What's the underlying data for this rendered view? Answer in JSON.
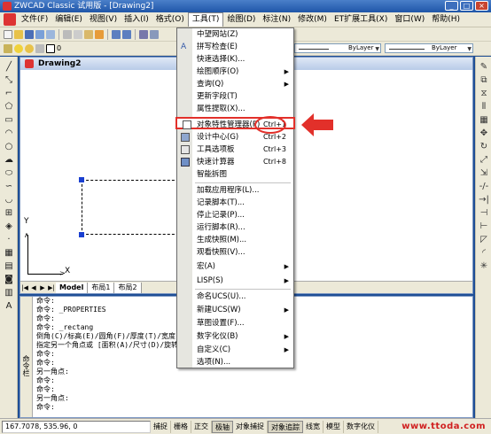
{
  "window": {
    "title": "ZWCAD Classic 试用版 - [Drawing2]"
  },
  "menubar": {
    "items": [
      "文件(F)",
      "编辑(E)",
      "视图(V)",
      "插入(I)",
      "格式(O)",
      "工具(T)",
      "绘图(D)",
      "标注(N)",
      "修改(M)",
      "ET扩展工具(X)",
      "窗口(W)",
      "帮助(H)"
    ]
  },
  "toolbar": {
    "layer_value": "0",
    "linetype_value": "ByLayer",
    "lineweight_value": "ByLayer"
  },
  "document": {
    "tab_title": "Drawing2"
  },
  "layout_tabs": [
    "Model",
    "布局1",
    "布局2"
  ],
  "ucs": {
    "x_label": "X",
    "y_label": "Y"
  },
  "tools_menu": {
    "items": [
      {
        "label": "中望网站(Z)",
        "shortcut": "",
        "submenu": false
      },
      {
        "label": "拼写检查(E)",
        "shortcut": "",
        "submenu": false
      },
      {
        "label": "快速选择(K)...",
        "shortcut": "",
        "submenu": false
      },
      {
        "label": "绘图顺序(O)",
        "shortcut": "",
        "submenu": true
      },
      {
        "label": "查询(Q)",
        "shortcut": "",
        "submenu": true
      },
      {
        "label": "更新字段(T)",
        "shortcut": "",
        "submenu": false
      },
      {
        "label": "属性提取(X)...",
        "shortcut": "",
        "submenu": false
      },
      {
        "label": "对象特性管理器(P)",
        "shortcut": "Ctrl+1",
        "submenu": false,
        "highlighted": true
      },
      {
        "label": "设计中心(G)",
        "shortcut": "Ctrl+2",
        "submenu": false
      },
      {
        "label": "工具选项板",
        "shortcut": "Ctrl+3",
        "submenu": false
      },
      {
        "label": "快速计算器",
        "shortcut": "Ctrl+8",
        "submenu": false
      },
      {
        "label": "智能拆图",
        "shortcut": "",
        "submenu": false
      },
      {
        "label": "加载应用程序(L)...",
        "shortcut": "",
        "submenu": false
      },
      {
        "label": "记录脚本(T)...",
        "shortcut": "",
        "submenu": false
      },
      {
        "label": "停止记录(P)...",
        "shortcut": "",
        "submenu": false
      },
      {
        "label": "运行脚本(R)...",
        "shortcut": "",
        "submenu": false
      },
      {
        "label": "生成快照(M)...",
        "shortcut": "",
        "submenu": false
      },
      {
        "label": "观看快照(V)...",
        "shortcut": "",
        "submenu": false
      },
      {
        "label": "宏(A)",
        "shortcut": "",
        "submenu": true
      },
      {
        "label": "LISP(S)",
        "shortcut": "",
        "submenu": true
      },
      {
        "label": "命名UCS(U)...",
        "shortcut": "",
        "submenu": false
      },
      {
        "label": "新建UCS(W)",
        "shortcut": "",
        "submenu": true
      },
      {
        "label": "草图设置(F)...",
        "shortcut": "",
        "submenu": false
      },
      {
        "label": "数字化仪(B)",
        "shortcut": "",
        "submenu": true
      },
      {
        "label": "自定义(C)",
        "shortcut": "",
        "submenu": true
      },
      {
        "label": "选项(N)...",
        "shortcut": "",
        "submenu": false
      }
    ]
  },
  "command_window": {
    "side_label": "命令栏",
    "lines": [
      "命令:",
      "命令: _PROPERTIES",
      "命令:",
      "命令: _rectang",
      "倒角(C)/标高(E)/圆角(F)/厚度(T)/宽度(W)/<选取第一个角点>:",
      "指定另一个角点或 [面积(A)/尺寸(D)/旋转(R)]:",
      "命令:",
      "命令:",
      "另一角点:",
      "命令:",
      "命令:",
      "另一角点:",
      "命令:"
    ]
  },
  "statusbar": {
    "coords": "167.7078,  535.96,  0",
    "toggles": [
      {
        "label": "捕捉",
        "on": false
      },
      {
        "label": "栅格",
        "on": false
      },
      {
        "label": "正交",
        "on": false
      },
      {
        "label": "极轴",
        "on": true
      },
      {
        "label": "对象捕捉",
        "on": false
      },
      {
        "label": "对象追踪",
        "on": true
      },
      {
        "label": "线宽",
        "on": false
      },
      {
        "label": "模型",
        "on": false
      },
      {
        "label": "数字化仪",
        "on": false
      }
    ]
  },
  "watermark": {
    "text": "www.ttoda.com"
  },
  "colors": {
    "highlight_ring": "#e2302a",
    "arrow": "#e2302a",
    "accent": "#1f56a8"
  }
}
